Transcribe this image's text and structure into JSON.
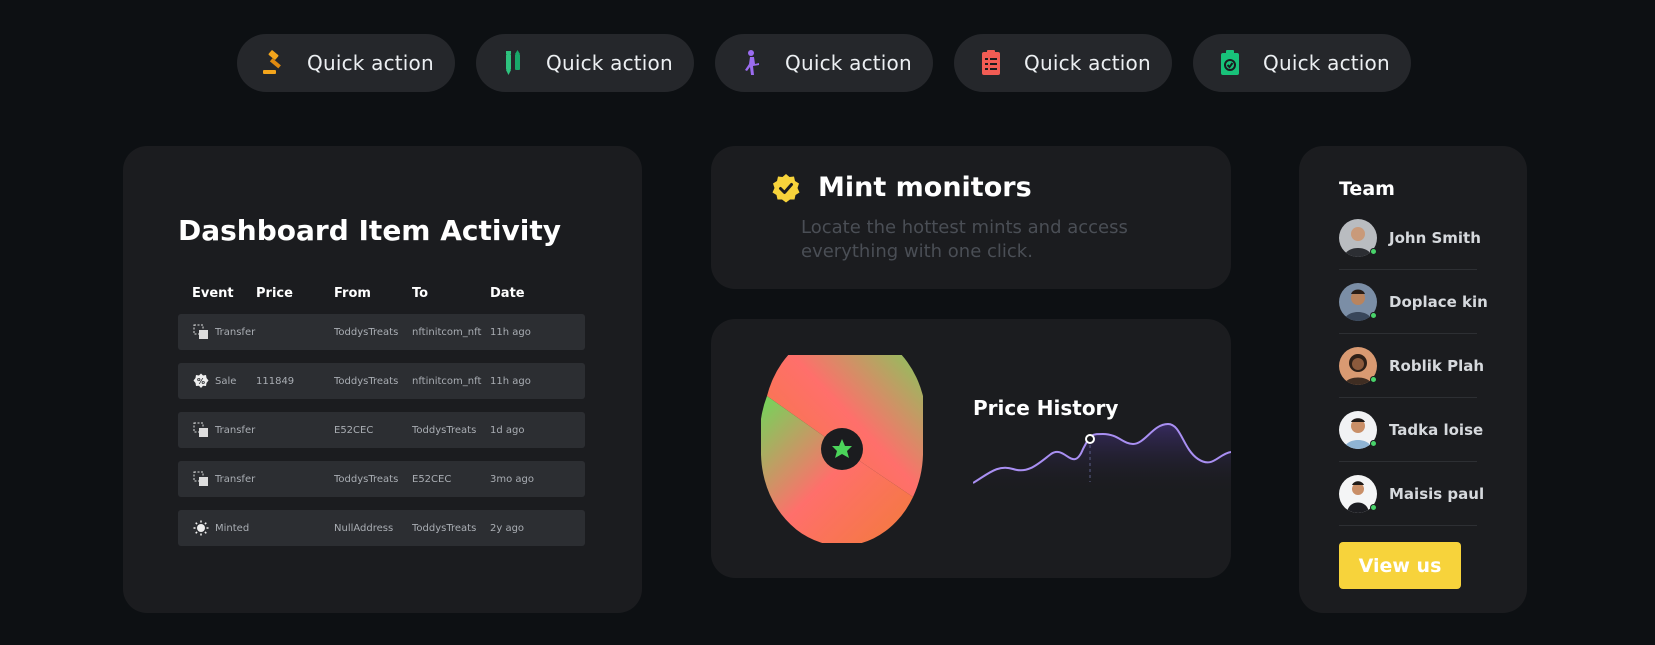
{
  "quick_actions": [
    {
      "label": "Quick action",
      "icon": "gavel-icon",
      "color": "#f4a51c"
    },
    {
      "label": "Quick action",
      "icon": "pencils-icon",
      "color": "#2ec27e"
    },
    {
      "label": "Quick action",
      "icon": "runner-icon",
      "color": "#9b6cf0"
    },
    {
      "label": "Quick action",
      "icon": "checklist-icon",
      "color": "#f25c54"
    },
    {
      "label": "Quick action",
      "icon": "clipboard-check-icon",
      "color": "#18c27a"
    }
  ],
  "activity": {
    "title": "Dashboard Item Activity",
    "headers": [
      "Event",
      "Price",
      "From",
      "To",
      "Date"
    ],
    "rows": [
      {
        "event": "Transfer",
        "icon": "transfer-icon",
        "price": "",
        "from": "ToddysTreats",
        "to": "nftinitcom_nft",
        "date": "11h ago"
      },
      {
        "event": "Sale",
        "icon": "sale-icon",
        "price": "111849",
        "from": "ToddysTreats",
        "to": "nftinitcom_nft",
        "date": "11h ago"
      },
      {
        "event": "Transfer",
        "icon": "transfer-icon",
        "price": "",
        "from": "E52CEC",
        "to": "ToddysTreats",
        "date": "1d ago"
      },
      {
        "event": "Transfer",
        "icon": "transfer-icon",
        "price": "",
        "from": "ToddysTreats",
        "to": "E52CEC",
        "date": "3mo ago"
      },
      {
        "event": "Minted",
        "icon": "minted-icon",
        "price": "",
        "from": "NullAddress",
        "to": "ToddysTreats",
        "date": "2y ago"
      }
    ]
  },
  "mint": {
    "title": "Mint monitors",
    "description": "Locate the hottest mints and access everything with one click.",
    "badge_color": "#f7d33b"
  },
  "price_history": {
    "title": "Price History"
  },
  "team": {
    "title": "Team",
    "members": [
      {
        "name": "John Smith"
      },
      {
        "name": "Doplace kin"
      },
      {
        "name": "Roblik Plah"
      },
      {
        "name": "Tadka loise"
      },
      {
        "name": "Maisis paul"
      }
    ],
    "button_label": "View us",
    "online_color": "#48d36a"
  }
}
